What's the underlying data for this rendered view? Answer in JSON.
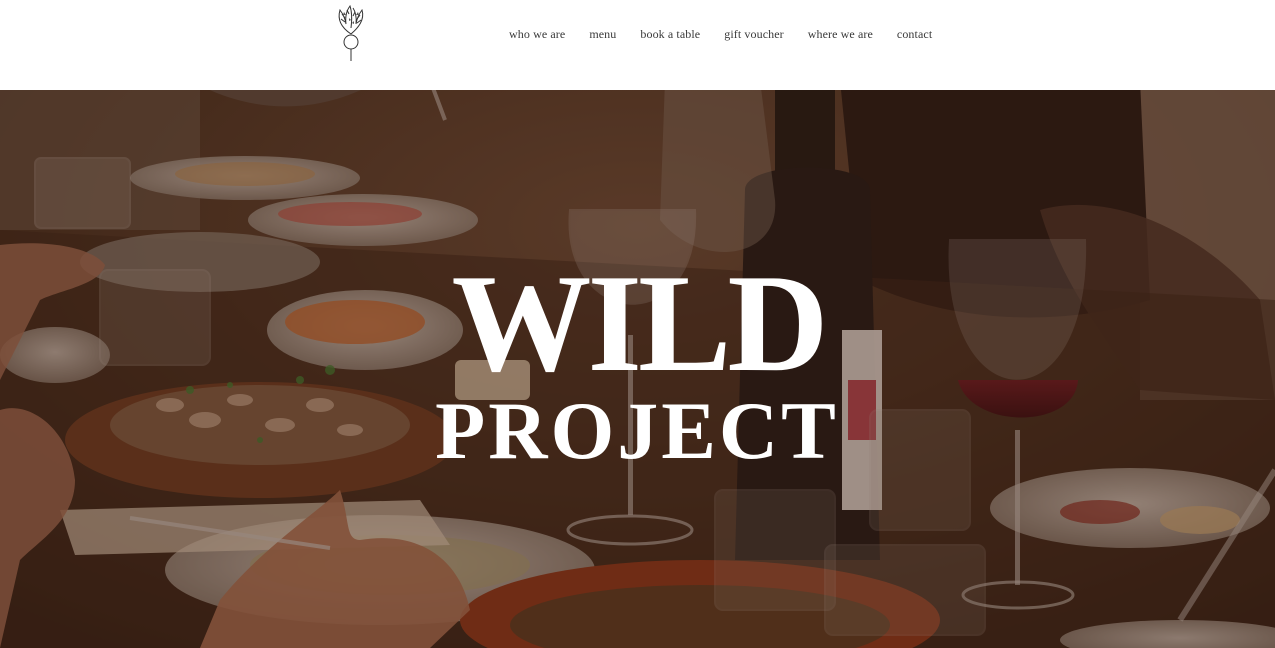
{
  "brand": {
    "logo_icon": "radish-illustration-icon"
  },
  "nav": {
    "items": [
      {
        "label": "who we are"
      },
      {
        "label": "menu"
      },
      {
        "label": "book a table"
      },
      {
        "label": "gift voucher"
      },
      {
        "label": "where we are"
      },
      {
        "label": "contact"
      }
    ]
  },
  "hero": {
    "title_line1": "WILD",
    "title_line2": "PROJECT",
    "overlay_color": "#3b1d12"
  }
}
